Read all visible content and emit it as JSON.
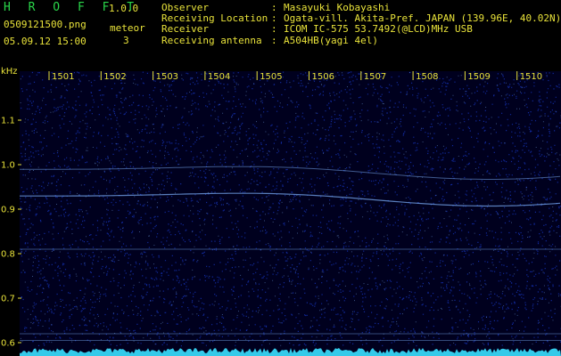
{
  "header": {
    "app_title": "H R O F F T",
    "version": "1.0.0",
    "filename": "0509121500.png",
    "datetime": "05.09.12 15:00",
    "meteor_label": "meteor",
    "meteor_count": "3"
  },
  "info": {
    "rows": [
      {
        "key": "Observer",
        "sep": ":",
        "value": "Masayuki Kobayashi"
      },
      {
        "key": "Receiving Location",
        "sep": ":",
        "value": "Ogata-vill. Akita-Pref. JAPAN (139.96E, 40.02N)"
      },
      {
        "key": "Receiver",
        "sep": ":",
        "value": "ICOM IC-575 53.7492(@LCD)MHz USB"
      },
      {
        "key": "Receiving antenna",
        "sep": ":",
        "value": "A504HB(yagi 4el)"
      }
    ]
  },
  "spectrogram": {
    "y_unit": "kHz",
    "y_ticks": [
      "1.1",
      "1.0",
      "0.9",
      "0.8",
      "0.7",
      "0.6"
    ],
    "y_range": [
      0.57,
      1.21
    ],
    "minute_labels": [
      "1501",
      "1502",
      "1503",
      "1504",
      "1505",
      "1506",
      "1507",
      "1508",
      "1509",
      "1510"
    ],
    "colors": {
      "label": "#e8e23a",
      "background": "#00001e",
      "noise": "#1f49ff",
      "trace": "#7fb4ff",
      "baseline": "#3ae0ff"
    }
  }
}
